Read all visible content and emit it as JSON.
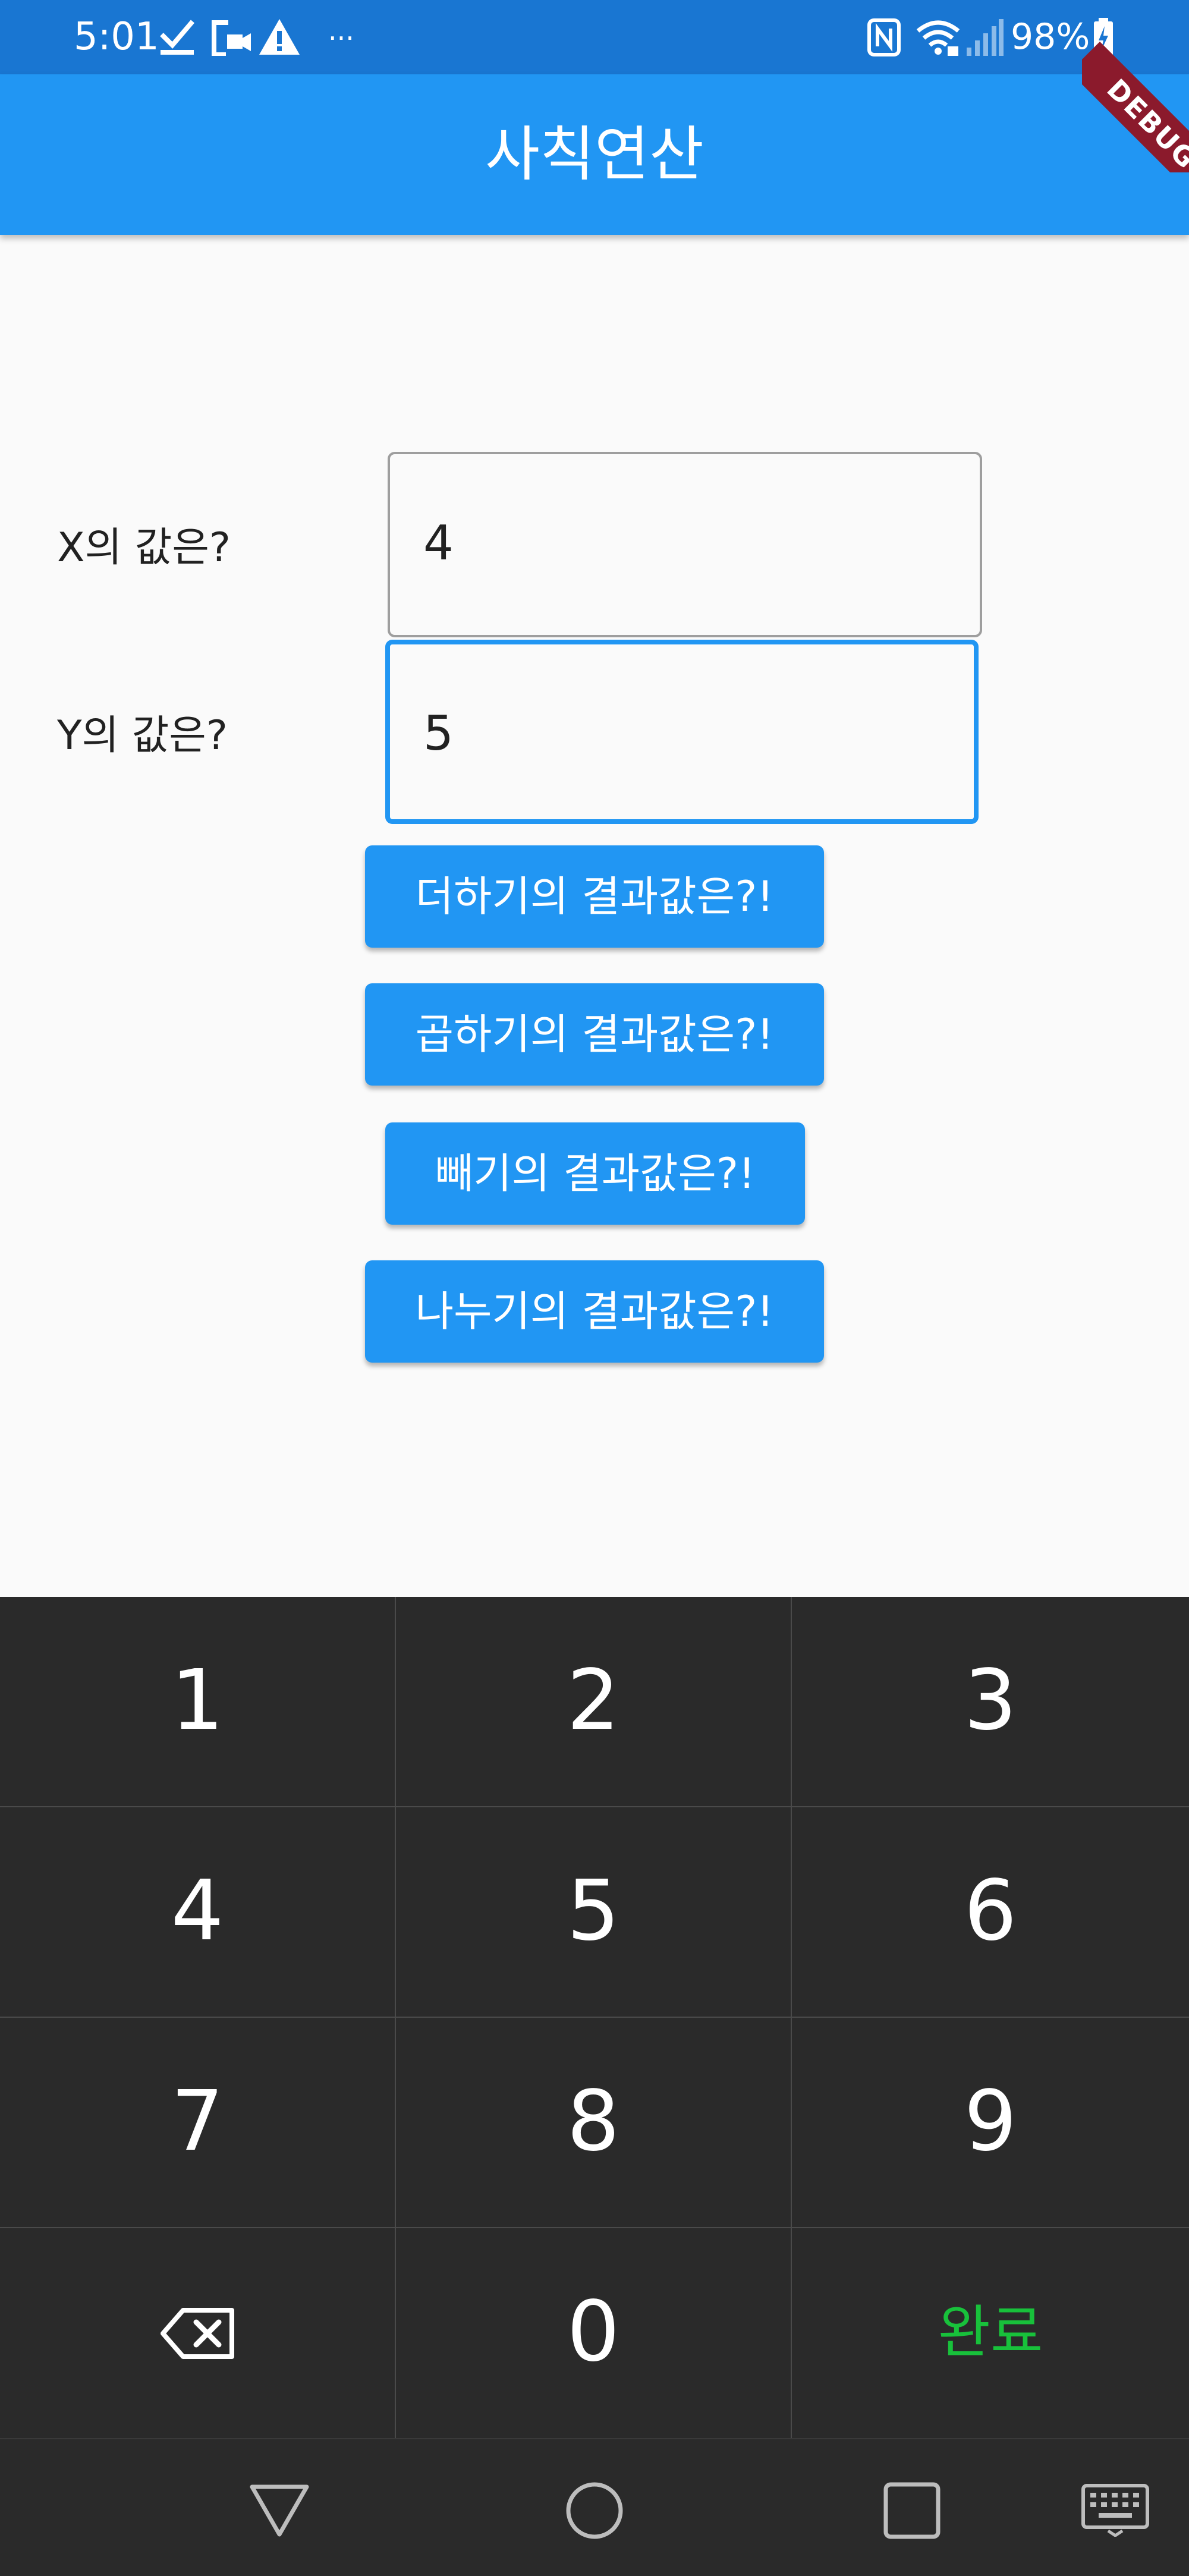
{
  "status_bar": {
    "time": "5:01",
    "battery": "98%",
    "overflow": "···",
    "icons": [
      "check-icon",
      "video-device-icon",
      "warning-icon",
      "nfc-icon",
      "wifi-icon",
      "signal-icon",
      "battery-charging-icon"
    ]
  },
  "app_bar": {
    "title": "사칙연산"
  },
  "debug_banner": {
    "label": "DEBUG"
  },
  "form": {
    "x_label": "X의 값은?",
    "x_value": "4",
    "y_label": "Y의 값은?",
    "y_value": "5"
  },
  "buttons": {
    "add": "더하기의 결과값은?!",
    "multiply": "곱하기의 결과값은?!",
    "subtract": "빼기의 결과값은?!",
    "divide": "나누기의 결과값은?!"
  },
  "keypad": {
    "keys": [
      "1",
      "2",
      "3",
      "4",
      "5",
      "6",
      "7",
      "8",
      "9",
      "0"
    ],
    "done": "완료",
    "backspace_icon": "backspace-icon",
    "done_color": "#18c13b"
  },
  "nav_bar": {
    "icons": [
      "back-icon",
      "home-icon",
      "recents-icon",
      "keyboard-icon"
    ]
  },
  "colors": {
    "primary": "#2196f3",
    "status_bar": "#1976d2",
    "keypad_bg": "#2a2a2a",
    "debug": "#8b1a2c"
  }
}
